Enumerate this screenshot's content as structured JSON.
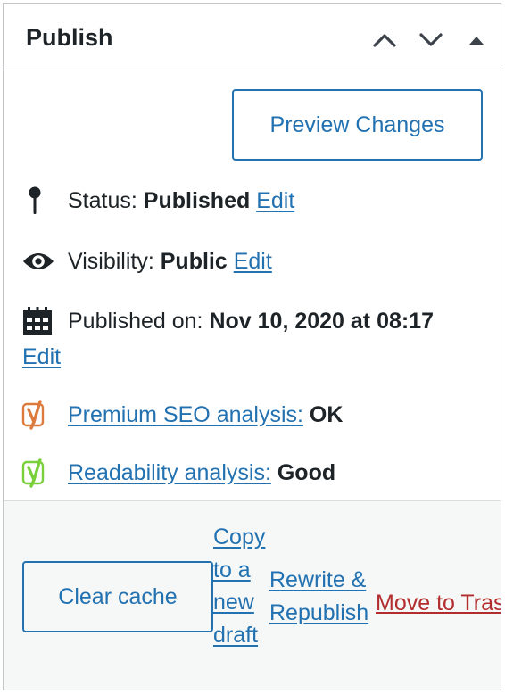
{
  "panel": {
    "title": "Publish",
    "controls": [
      "move-up-icon",
      "move-down-icon",
      "toggle-panel-icon"
    ]
  },
  "preview_button": "Preview Changes",
  "status": {
    "label": "Status:",
    "value": "Published",
    "edit": "Edit",
    "icon": "pin-icon"
  },
  "visibility": {
    "label": "Visibility:",
    "value": "Public",
    "edit": "Edit",
    "icon": "eye-icon"
  },
  "published_on": {
    "label": "Published on:",
    "value": "Nov 10, 2020 at 08:17",
    "edit": "Edit",
    "icon": "calendar-icon"
  },
  "seo": {
    "link": "Premium SEO analysis:",
    "value": "OK",
    "icon": "yoast-icon",
    "color": "#dd7b3e"
  },
  "readability": {
    "link": "Readability analysis:",
    "value": "Good",
    "icon": "yoast-icon",
    "color": "#7ad03a"
  },
  "footer": {
    "clear_cache": "Clear cache",
    "copy_draft": "Copy to a new draft",
    "rewrite_republish": "Rewrite & Republish",
    "move_to_trash": "Move to Trash"
  },
  "colors": {
    "accent": "#2271b1",
    "danger": "#b32d2e",
    "border": "#c3c4c7",
    "footer_bg": "#f6f7f7"
  }
}
